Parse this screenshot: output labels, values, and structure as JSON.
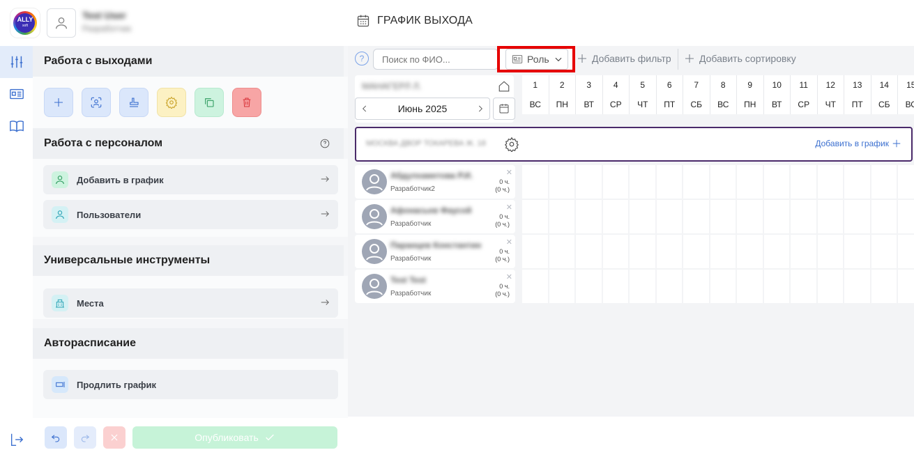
{
  "header": {
    "logo_text": "ALLY",
    "logo_sub": "soft",
    "user_name": "Test User",
    "user_role": "Разработчик",
    "page_title": "ГРАФИК ВЫХОДА"
  },
  "panel": {
    "section_exits": "Работа с выходами",
    "section_staff": "Работа с персоналом",
    "staff_items": [
      {
        "label": "Добавить в график"
      },
      {
        "label": "Пользователи"
      }
    ],
    "section_tools": "Универсальные инструменты",
    "tools_items": [
      {
        "label": "Места"
      }
    ],
    "section_auto": "Авторасписание",
    "auto_items": [
      {
        "label": "Продлить график"
      }
    ],
    "publish_label": "Опубликовать"
  },
  "toolbar": {
    "help": "?",
    "search_placeholder": "Поиск по ФИО...",
    "role_label": "Роль",
    "add_filter": "Добавить фильтр",
    "add_sort": "Добавить сортировку"
  },
  "calendar": {
    "location": "МАНАГЕРЛ Л.",
    "month": "Июнь 2025",
    "days": [
      {
        "n": "1",
        "d": "ВС"
      },
      {
        "n": "2",
        "d": "ПН"
      },
      {
        "n": "3",
        "d": "ВТ"
      },
      {
        "n": "4",
        "d": "СР"
      },
      {
        "n": "5",
        "d": "ЧТ"
      },
      {
        "n": "6",
        "d": "ПТ"
      },
      {
        "n": "7",
        "d": "СБ"
      },
      {
        "n": "8",
        "d": "ВС"
      },
      {
        "n": "9",
        "d": "ПН"
      },
      {
        "n": "10",
        "d": "ВТ"
      },
      {
        "n": "11",
        "d": "СР"
      },
      {
        "n": "12",
        "d": "ЧТ"
      },
      {
        "n": "13",
        "d": "ПТ"
      },
      {
        "n": "14",
        "d": "СБ"
      },
      {
        "n": "15",
        "d": "ВС"
      }
    ]
  },
  "group": {
    "name": "МОСКВА ДВОР ТОКАРЕВА Ж. 18",
    "add_label": "Добавить в график"
  },
  "employees": [
    {
      "name": "Абдулхаметова Р.И.",
      "role": "Разработчик2",
      "close": "✕",
      "hours": "0 ч.",
      "hours_sub": "(0 ч.)"
    },
    {
      "name": "Афонасьев Фаусой",
      "role": "Разработчик",
      "close": "✕",
      "hours": "0 ч.",
      "hours_sub": "(0 ч.)"
    },
    {
      "name": "Паранцев Константин",
      "role": "Разработчик",
      "close": "✕",
      "hours": "0 ч.",
      "hours_sub": "(0 ч.)"
    },
    {
      "name": "Test Test",
      "role": "Разработчик",
      "close": "✕",
      "hours": "0 ч.",
      "hours_sub": "(0 ч.)"
    }
  ],
  "colors": {
    "accent": "#3b6fcf",
    "highlight": "#e60000",
    "group_border": "#4a2a6a",
    "publish_bg": "#c6f3d8"
  }
}
